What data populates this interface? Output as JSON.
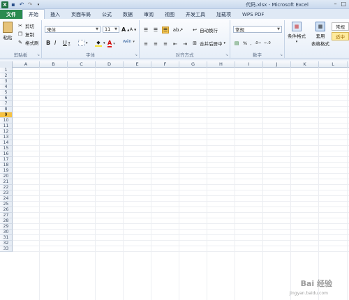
{
  "app": {
    "window_title": "代码.xlsx - Microsoft Excel",
    "qat_icons": [
      "excel-icon",
      "save-icon",
      "undo-icon",
      "redo-icon"
    ]
  },
  "tabs": [
    {
      "label": "文件",
      "kind": "file"
    },
    {
      "label": "开始",
      "kind": "active"
    },
    {
      "label": "插入"
    },
    {
      "label": "页面布局"
    },
    {
      "label": "公式"
    },
    {
      "label": "数据"
    },
    {
      "label": "审阅"
    },
    {
      "label": "视图"
    },
    {
      "label": "开发工具"
    },
    {
      "label": "加载项"
    },
    {
      "label": "WPS PDF"
    }
  ],
  "ribbon": {
    "clipboard": {
      "label": "剪贴板",
      "paste": "粘贴",
      "cut": "剪切",
      "copy": "复制",
      "format_painter": "格式刷"
    },
    "font": {
      "label": "字体",
      "font_name": "宋体",
      "font_size": "11",
      "bold": "B",
      "italic": "I",
      "underline": "U",
      "grow": "A",
      "shrink": "A",
      "font_color": "A",
      "wen": "wén"
    },
    "alignment": {
      "label": "对齐方式",
      "wrap_text": "自动换行",
      "merge_center": "合并后居中"
    },
    "number": {
      "label": "数字",
      "format": "常规",
      "percent": "%",
      "comma": ","
    },
    "styles": {
      "conditional": "条件格式",
      "table_format_line1": "套用",
      "table_format_line2": "表格格式",
      "style_normal": "常规",
      "style_mid": "适中"
    }
  },
  "grid": {
    "columns": [
      "A",
      "B",
      "C",
      "D",
      "E",
      "F",
      "G",
      "H",
      "I",
      "J",
      "K",
      "L"
    ],
    "rows": [
      "1",
      "2",
      "3",
      "4",
      "5",
      "6",
      "7",
      "8",
      "9",
      "10",
      "11",
      "12",
      "13",
      "14",
      "15",
      "16",
      "17",
      "18",
      "19",
      "20",
      "21",
      "22",
      "23",
      "24",
      "25",
      "26",
      "27",
      "28",
      "29",
      "30",
      "31",
      "32",
      "33"
    ],
    "selected_row": "9"
  },
  "watermark": {
    "text": "Bai 经验",
    "sub": "jingyan.baidu.com"
  }
}
